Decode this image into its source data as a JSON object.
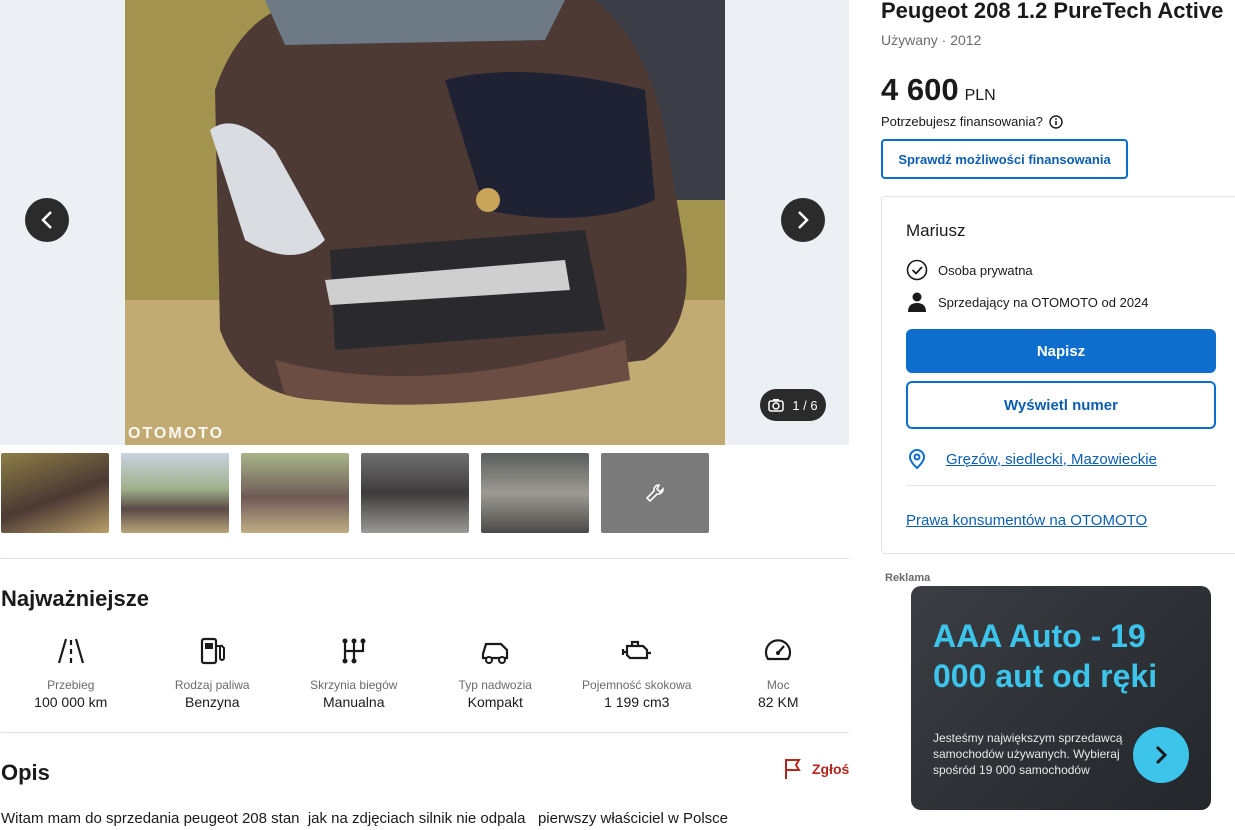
{
  "listing": {
    "title": "Peugeot 208 1.2 PureTech Active",
    "subtitle": "Używany · 2012",
    "price_amount": "4 600",
    "price_currency": "PLN",
    "financing_question": "Potrzebujesz finansowania?",
    "financing_button": "Sprawdź możliwości finansowania"
  },
  "gallery": {
    "counter": "1 / 6",
    "watermark": "OTOMOTO",
    "thumb_count": 6
  },
  "key_specs": {
    "title": "Najważniejsze",
    "items": [
      {
        "label": "Przebieg",
        "value": "100 000 km",
        "icon": "road-icon"
      },
      {
        "label": "Rodzaj paliwa",
        "value": "Benzyna",
        "icon": "fuel-pump-icon"
      },
      {
        "label": "Skrzynia biegów",
        "value": "Manualna",
        "icon": "gearbox-icon"
      },
      {
        "label": "Typ nadwozia",
        "value": "Kompakt",
        "icon": "car-body-icon"
      },
      {
        "label": "Pojemność skokowa",
        "value": "1 199 cm3",
        "icon": "engine-icon"
      },
      {
        "label": "Moc",
        "value": "82 KM",
        "icon": "speedometer-icon"
      }
    ]
  },
  "description": {
    "title": "Opis",
    "report_label": "Zgłoś",
    "text": "Witam mam do sprzedania peugeot 208 stan  jak na zdjęciach silnik nie odpala   pierwszy właściciel w Polsce"
  },
  "seller": {
    "name": "Mariusz",
    "type": "Osoba prywatna",
    "since": "Sprzedający na OTOMOTO od 2024",
    "message_button": "Napisz",
    "phone_button": "Wyświetl numer",
    "location": "Gręzów, siedlecki, Mazowieckie",
    "consumer_rights": "Prawa konsumentów na OTOMOTO"
  },
  "ad": {
    "label": "Reklama",
    "headline": "AAA Auto - 19 000 aut od ręki",
    "body": "Jesteśmy największym sprzedawcą samochodów używanych. Wybieraj spośród 19 000 samochodów",
    "accent": "#3dc4ea"
  },
  "colors": {
    "primary": "#0d6ece",
    "link": "#0d5eb2",
    "report": "#b3261e"
  }
}
